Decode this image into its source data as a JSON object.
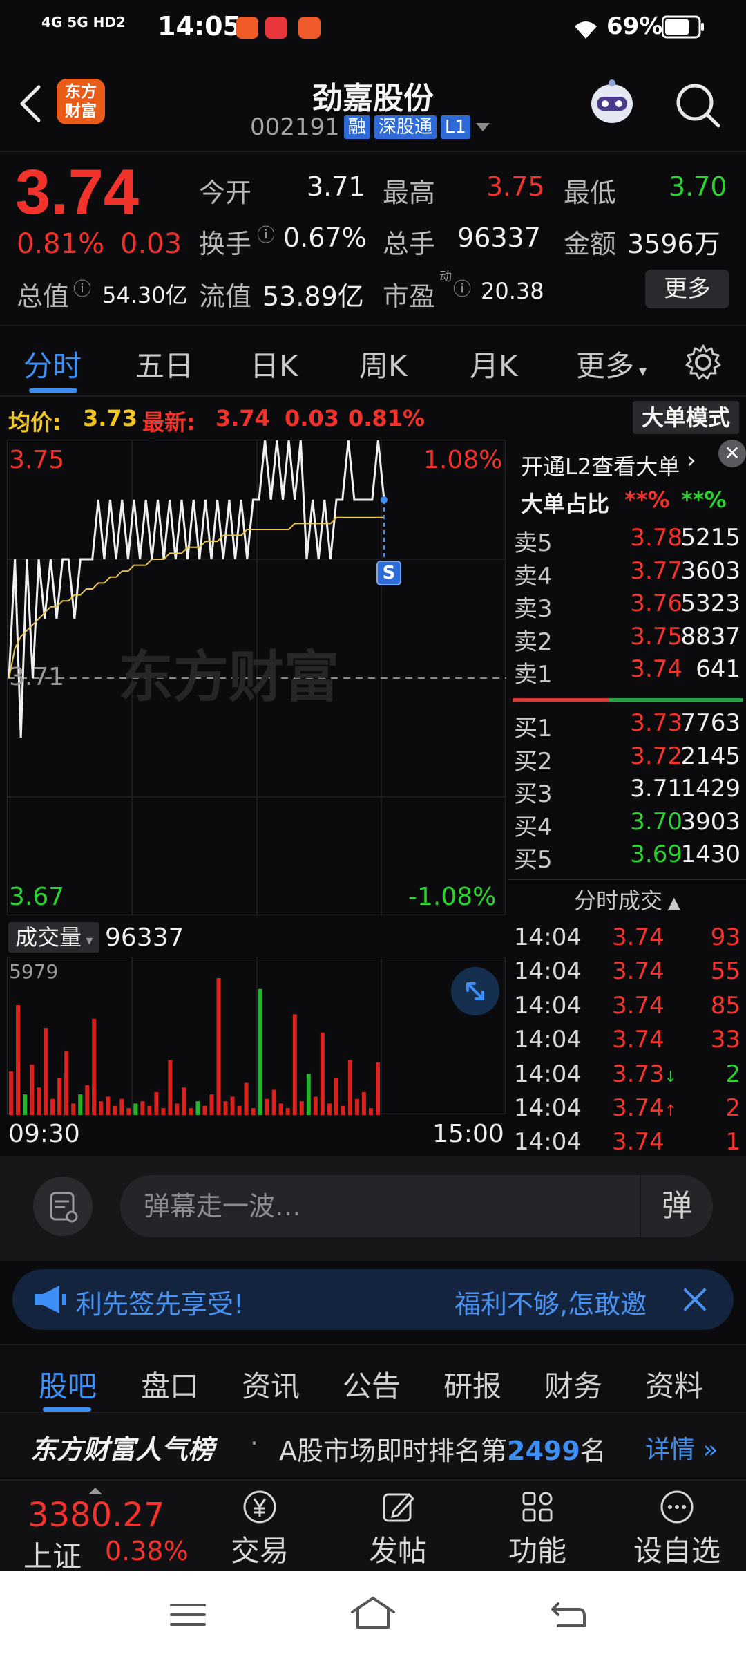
{
  "status": {
    "network": "4G 5G HD2",
    "time": "14:05",
    "battery": "69%"
  },
  "header": {
    "logo_line1": "东方",
    "logo_line2": "财富",
    "name": "劲嘉股份",
    "code": "002191",
    "tag_margin": "融",
    "tag_connect": "深股通",
    "tag_level": "L1"
  },
  "quote": {
    "price": "3.74",
    "change_pct": "0.81%",
    "change": "0.03",
    "open_label": "今开",
    "open": "3.71",
    "high_label": "最高",
    "high": "3.75",
    "low_label": "最低",
    "low": "3.70",
    "turnover_label": "换手",
    "turnover": "0.67%",
    "volume_label": "总手",
    "volume": "96337",
    "amount_label": "金额",
    "amount": "3596万",
    "total_cap_label": "总值",
    "total_cap": "54.30亿",
    "float_cap_label": "流值",
    "float_cap": "53.89亿",
    "pe_label": "市盈",
    "pe_sup": "动",
    "pe": "20.38",
    "more": "更多"
  },
  "tabs": {
    "items": [
      "分时",
      "五日",
      "日K",
      "周K",
      "月K",
      "更多"
    ],
    "active": 0
  },
  "avgbar": {
    "avg_label": "均价:",
    "avg": "3.73",
    "latest_label": "最新:",
    "latest": "3.74",
    "change": "0.03",
    "change_pct": "0.81%",
    "big_mode": "大单模式"
  },
  "chart_data": {
    "type": "line",
    "price_top": "3.75",
    "price_mid": "3.71",
    "price_bottom": "3.67",
    "pct_top": "1.08%",
    "pct_bottom": "-1.08%",
    "watermark": "东方财富",
    "marker": "S",
    "ylim": [
      3.67,
      3.75
    ],
    "x_start": "09:30",
    "x_end": "15:00",
    "price_series": [
      3.71,
      3.73,
      3.7,
      3.73,
      3.71,
      3.73,
      3.72,
      3.73,
      3.72,
      3.73,
      3.73,
      3.72,
      3.73,
      3.73,
      3.73,
      3.74,
      3.73,
      3.74,
      3.73,
      3.74,
      3.73,
      3.74,
      3.73,
      3.74,
      3.73,
      3.74,
      3.73,
      3.74,
      3.73,
      3.74,
      3.73,
      3.74,
      3.73,
      3.74,
      3.73,
      3.74,
      3.73,
      3.74,
      3.73,
      3.74,
      3.73,
      3.74,
      3.74,
      3.75,
      3.74,
      3.75,
      3.74,
      3.75,
      3.74,
      3.75,
      3.73,
      3.74,
      3.73,
      3.74,
      3.73,
      3.74,
      3.74,
      3.75,
      3.74,
      3.74,
      3.74,
      3.74,
      3.75,
      3.74
    ],
    "avg_series": [
      3.71,
      3.715,
      3.717,
      3.718,
      3.719,
      3.72,
      3.721,
      3.722,
      3.722,
      3.723,
      3.723,
      3.724,
      3.724,
      3.725,
      3.725,
      3.726,
      3.726,
      3.727,
      3.727,
      3.728,
      3.728,
      3.729,
      3.729,
      3.729,
      3.73,
      3.73,
      3.73,
      3.731,
      3.731,
      3.731,
      3.732,
      3.732,
      3.732,
      3.733,
      3.733,
      3.733,
      3.734,
      3.734,
      3.734,
      3.734,
      3.735,
      3.735,
      3.735,
      3.735,
      3.735,
      3.735,
      3.735,
      3.735,
      3.736,
      3.736,
      3.736,
      3.736,
      3.736,
      3.736,
      3.736,
      3.737,
      3.737,
      3.737,
      3.737,
      3.737,
      3.737,
      3.737,
      3.737,
      3.737
    ],
    "volume_label": "成交量",
    "volume_total": "96337",
    "volume_max_label": "5979",
    "volume_bars": [
      {
        "v": 1900,
        "c": "red"
      },
      {
        "v": 4800,
        "c": "red"
      },
      {
        "v": 900,
        "c": "green"
      },
      {
        "v": 2200,
        "c": "red"
      },
      {
        "v": 1200,
        "c": "red"
      },
      {
        "v": 3800,
        "c": "red"
      },
      {
        "v": 700,
        "c": "red"
      },
      {
        "v": 1600,
        "c": "red"
      },
      {
        "v": 2800,
        "c": "red"
      },
      {
        "v": 500,
        "c": "red"
      },
      {
        "v": 900,
        "c": "green"
      },
      {
        "v": 1300,
        "c": "red"
      },
      {
        "v": 4200,
        "c": "red"
      },
      {
        "v": 600,
        "c": "red"
      },
      {
        "v": 800,
        "c": "red"
      },
      {
        "v": 400,
        "c": "red"
      },
      {
        "v": 700,
        "c": "red"
      },
      {
        "v": 300,
        "c": "red"
      },
      {
        "v": 500,
        "c": "green"
      },
      {
        "v": 600,
        "c": "red"
      },
      {
        "v": 400,
        "c": "red"
      },
      {
        "v": 1000,
        "c": "red"
      },
      {
        "v": 300,
        "c": "red"
      },
      {
        "v": 2400,
        "c": "red"
      },
      {
        "v": 500,
        "c": "red"
      },
      {
        "v": 1200,
        "c": "red"
      },
      {
        "v": 300,
        "c": "red"
      },
      {
        "v": 600,
        "c": "green"
      },
      {
        "v": 400,
        "c": "red"
      },
      {
        "v": 900,
        "c": "red"
      },
      {
        "v": 5979,
        "c": "red"
      },
      {
        "v": 600,
        "c": "red"
      },
      {
        "v": 800,
        "c": "red"
      },
      {
        "v": 400,
        "c": "red"
      },
      {
        "v": 1400,
        "c": "red"
      },
      {
        "v": 300,
        "c": "red"
      },
      {
        "v": 5500,
        "c": "green"
      },
      {
        "v": 700,
        "c": "red"
      },
      {
        "v": 1100,
        "c": "red"
      },
      {
        "v": 500,
        "c": "red"
      },
      {
        "v": 300,
        "c": "red"
      },
      {
        "v": 4400,
        "c": "red"
      },
      {
        "v": 600,
        "c": "red"
      },
      {
        "v": 1800,
        "c": "green"
      },
      {
        "v": 800,
        "c": "red"
      },
      {
        "v": 3600,
        "c": "red"
      },
      {
        "v": 500,
        "c": "red"
      },
      {
        "v": 1600,
        "c": "red"
      },
      {
        "v": 400,
        "c": "red"
      },
      {
        "v": 2400,
        "c": "red"
      },
      {
        "v": 700,
        "c": "red"
      },
      {
        "v": 1000,
        "c": "red"
      },
      {
        "v": 300,
        "c": "red"
      },
      {
        "v": 2300,
        "c": "red"
      }
    ]
  },
  "right_panel": {
    "promo": "开通L2查看大单",
    "ratio_label": "大单占比",
    "ratio_red": "**%",
    "ratio_green": "**%",
    "asks": [
      {
        "label": "卖5",
        "price": "3.78",
        "qty": "5215",
        "color": "red"
      },
      {
        "label": "卖4",
        "price": "3.77",
        "qty": "3603",
        "color": "red"
      },
      {
        "label": "卖3",
        "price": "3.76",
        "qty": "5323",
        "color": "red"
      },
      {
        "label": "卖2",
        "price": "3.75",
        "qty": "8837",
        "color": "red"
      },
      {
        "label": "卖1",
        "price": "3.74",
        "qty": "641",
        "color": "red"
      }
    ],
    "bids": [
      {
        "label": "买1",
        "price": "3.73",
        "qty": "7763",
        "color": "red"
      },
      {
        "label": "买2",
        "price": "3.72",
        "qty": "2145",
        "color": "red"
      },
      {
        "label": "买3",
        "price": "3.71",
        "qty": "1429",
        "color": "white"
      },
      {
        "label": "买4",
        "price": "3.70",
        "qty": "3903",
        "color": "green"
      },
      {
        "label": "买5",
        "price": "3.69",
        "qty": "1430",
        "color": "green"
      }
    ],
    "ticks_title": "分时成交",
    "ticks": [
      {
        "time": "14:04",
        "price": "3.74",
        "arrow": "",
        "qty": "93",
        "qcolor": "red"
      },
      {
        "time": "14:04",
        "price": "3.74",
        "arrow": "",
        "qty": "55",
        "qcolor": "red"
      },
      {
        "time": "14:04",
        "price": "3.74",
        "arrow": "",
        "qty": "85",
        "qcolor": "red"
      },
      {
        "time": "14:04",
        "price": "3.74",
        "arrow": "",
        "qty": "33",
        "qcolor": "red"
      },
      {
        "time": "14:04",
        "price": "3.73",
        "arrow": "↓",
        "qty": "2",
        "qcolor": "green"
      },
      {
        "time": "14:04",
        "price": "3.74",
        "arrow": "↑",
        "qty": "2",
        "qcolor": "red"
      },
      {
        "time": "14:04",
        "price": "3.74",
        "arrow": "",
        "qty": "1",
        "qcolor": "red"
      }
    ]
  },
  "danmaku": {
    "placeholder": "弹幕走一波…",
    "send": "弹"
  },
  "banner": {
    "left_text": "利先签先享受!",
    "right_text": "福利不够,怎敢邀"
  },
  "subtabs": {
    "items": [
      "股吧",
      "盘口",
      "资讯",
      "公告",
      "研报",
      "财务",
      "资料"
    ],
    "active": 0
  },
  "popular": {
    "title": "东方财富人气榜",
    "text_before": "A股市场即时排名第",
    "rank": "2499",
    "text_after": "名",
    "detail": "详情"
  },
  "bottomnav": {
    "index_value": "3380.27",
    "index_name": "上证",
    "index_change": "0.38%",
    "items": [
      "交易",
      "发帖",
      "功能",
      "设自选"
    ]
  }
}
